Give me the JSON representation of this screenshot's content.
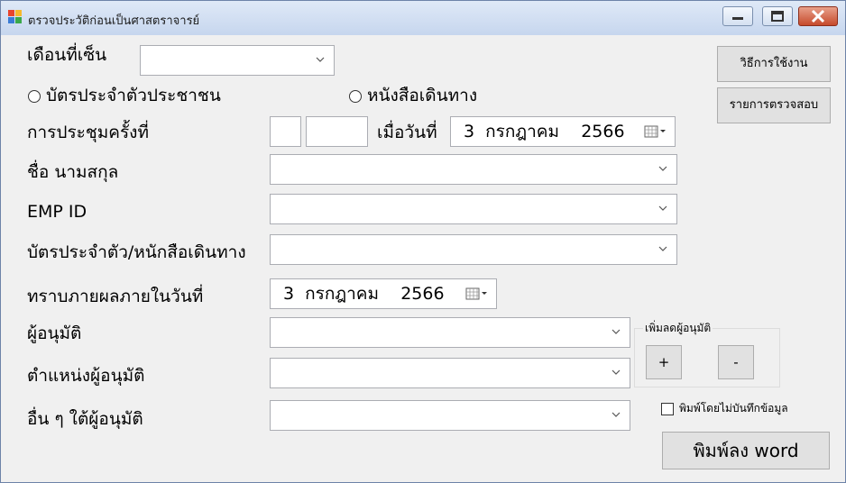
{
  "window": {
    "title": "ตรวจประวัติก่อนเป็นศาสตราจารย์"
  },
  "labels": {
    "month": "เดือนที่เซ็น",
    "meeting": "การประชุมครั้งที่",
    "on_date": "เมื่อวันที่",
    "name": "ชื่อ นามสกุล",
    "emp_id": "EMP ID",
    "id_card": "บัตรประจำตัว/หนักสือเดินทาง",
    "result_date": "ทราบภายผลภายในวันที่",
    "approver": "ผู้อนุมัติ",
    "approver_position": "ตำแหน่งผู้อนุมัติ",
    "other_approver": "อื่น ๆ ใต้ผู้อนุมัติ"
  },
  "radios": {
    "id_card": "บัตรประจำตัวประชาชน",
    "passport": "หนังสือเดินทาง"
  },
  "dates": {
    "meeting_date": "3  กรกฎาคม    2566",
    "result_date": "3  กรกฎาคม    2566"
  },
  "buttons": {
    "how_to": "วิธีการใช้งาน",
    "check_list": "รายการตรวจสอบ",
    "add": "+",
    "remove": "-",
    "print_word": "พิมพ์ลง word"
  },
  "group": {
    "title": "เพิ่มลดผู้อนุมัติ"
  },
  "checkbox": {
    "print_no_save": "พิมพ์โดยไม่บันทึกข้อมูล"
  }
}
